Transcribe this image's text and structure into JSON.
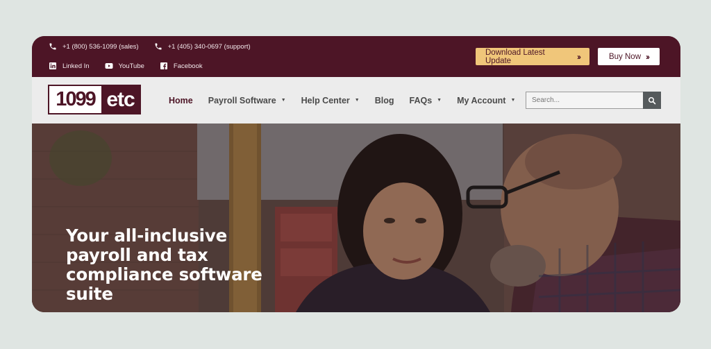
{
  "topbar": {
    "contacts": [
      {
        "icon": "phone-icon",
        "text": "+1 (800) 536-1099 (sales)"
      },
      {
        "icon": "phone-icon",
        "text": "+1 (405) 340-0697 (support)"
      }
    ],
    "socials": [
      {
        "icon": "linkedin-icon",
        "text": "Linked In"
      },
      {
        "icon": "youtube-icon",
        "text": "YouTube"
      },
      {
        "icon": "facebook-icon",
        "text": "Facebook"
      }
    ],
    "download_label": "Download Latest Update",
    "buy_label": "Buy Now"
  },
  "logo": {
    "part_a": "1099",
    "part_b": "etc"
  },
  "nav": {
    "items": [
      {
        "label": "Home",
        "active": true,
        "dropdown": false
      },
      {
        "label": "Payroll Software",
        "active": false,
        "dropdown": true
      },
      {
        "label": "Help Center",
        "active": false,
        "dropdown": true
      },
      {
        "label": "Blog",
        "active": false,
        "dropdown": false
      },
      {
        "label": "FAQs",
        "active": false,
        "dropdown": true
      },
      {
        "label": "My Account",
        "active": false,
        "dropdown": true
      }
    ]
  },
  "search": {
    "placeholder": "Search..."
  },
  "hero": {
    "title_lines": [
      "Your all-inclusive",
      "payroll and tax",
      "compliance software",
      "suite"
    ]
  },
  "colors": {
    "brand": "#4d1526",
    "accent": "#f0c67a",
    "nav_bg": "#ececec",
    "page_bg": "#dfe5e2"
  }
}
